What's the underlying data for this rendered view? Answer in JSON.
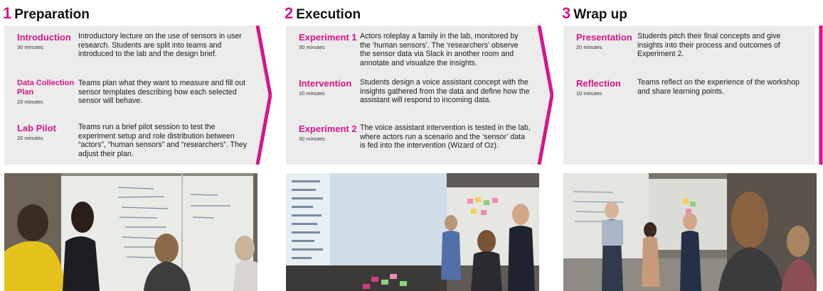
{
  "phases": [
    {
      "number": "1",
      "title": "Preparation",
      "items": [
        {
          "name": "Introduction",
          "duration": "30 minutes",
          "description": "Introductory lecture on the use of sensors in user research. Students are split into teams and introduced to the lab and the design brief."
        },
        {
          "name": "Data Collection Plan",
          "duration": "20 minutes",
          "description": "Teams plan what they want to measure and fill out sensor templates describing how each selected sensor will behave."
        },
        {
          "name": "Lab Pilot",
          "duration": "20 minutes",
          "description": "Teams run a brief pilot session to test the experiment setup and role distribution between “actors”, “human sensors” and “researchers”. They adjust their plan."
        }
      ]
    },
    {
      "number": "2",
      "title": "Execution",
      "items": [
        {
          "name": "Experiment 1",
          "duration": "30 minutes",
          "description": "Actors roleplay a family in the lab, monitored by the ‘human sensors’. The ‘researchers’ observe the sensor data via Slack in another room and annotate and visualize the insights."
        },
        {
          "name": "Intervention",
          "duration": "10 minutes",
          "description": "Students design a voice assistant concept with the insights gathered from the data and define how the assistant will respond to incoming data."
        },
        {
          "name": "Experiment 2",
          "duration": "30 minutes",
          "description": "The voice assistant intervention is tested in the lab, where actors run a scenario and the ‘sensor’ data is fed into the intervention (Wizard of Oz)."
        }
      ]
    },
    {
      "number": "3",
      "title": "Wrap up",
      "items": [
        {
          "name": "Presentation",
          "duration": "20 minutes",
          "description": "Students pitch their final concepts and give insights into their process and outcomes of Experiment 2."
        },
        {
          "name": "Reflection",
          "duration": "10 minutes",
          "description": "Teams reflect on the experience of the workshop and share learning points."
        }
      ]
    }
  ],
  "colors": {
    "accent": "#d6168b",
    "panel": "#ececec"
  },
  "photos": [
    {
      "subject": "students writing on whiteboard"
    },
    {
      "subject": "students watching projected slack screen"
    },
    {
      "subject": "students presenting in lab"
    }
  ]
}
